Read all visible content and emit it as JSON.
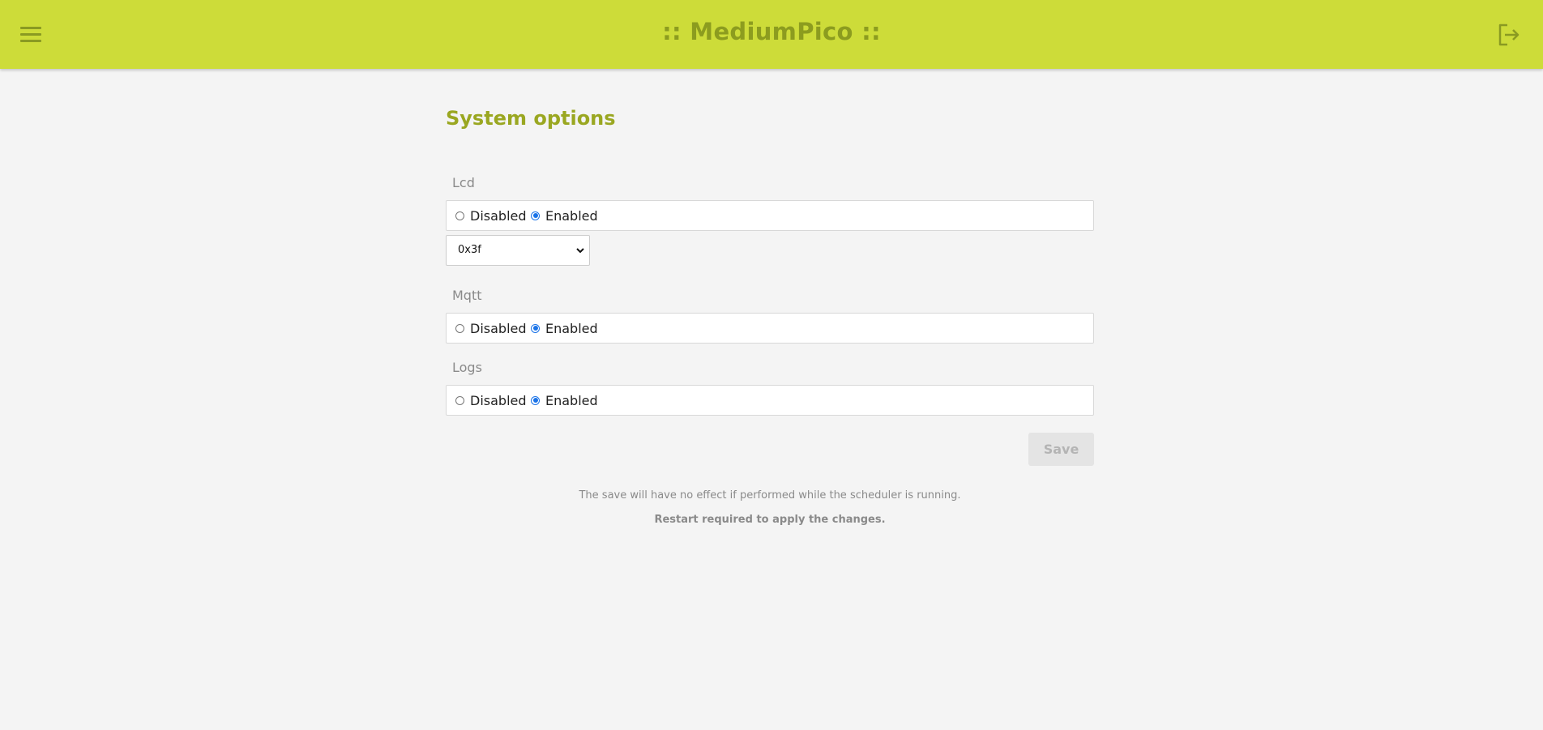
{
  "header": {
    "title": ":: MediumPico ::",
    "menu_icon": "hamburger-menu-icon",
    "logout_icon": "logout-icon",
    "background_color": "#cddc39",
    "title_color": "#8c9c1f"
  },
  "page": {
    "title": "System options",
    "title_color": "#9aa721"
  },
  "sections": {
    "lcd": {
      "label": "Lcd",
      "disabled_label": "Disabled",
      "enabled_label": "Enabled",
      "selected": "Enabled",
      "address_select_value": "0x3f"
    },
    "mqtt": {
      "label": "Mqtt",
      "disabled_label": "Disabled",
      "enabled_label": "Enabled",
      "selected": "Enabled"
    },
    "logs": {
      "label": "Logs",
      "disabled_label": "Disabled",
      "enabled_label": "Enabled",
      "selected": "Enabled"
    }
  },
  "actions": {
    "save_label": "Save"
  },
  "notes": {
    "scheduler_warning": "The save will have no effect if performed while the scheduler is running.",
    "restart_notice": "Restart required to apply the changes."
  }
}
